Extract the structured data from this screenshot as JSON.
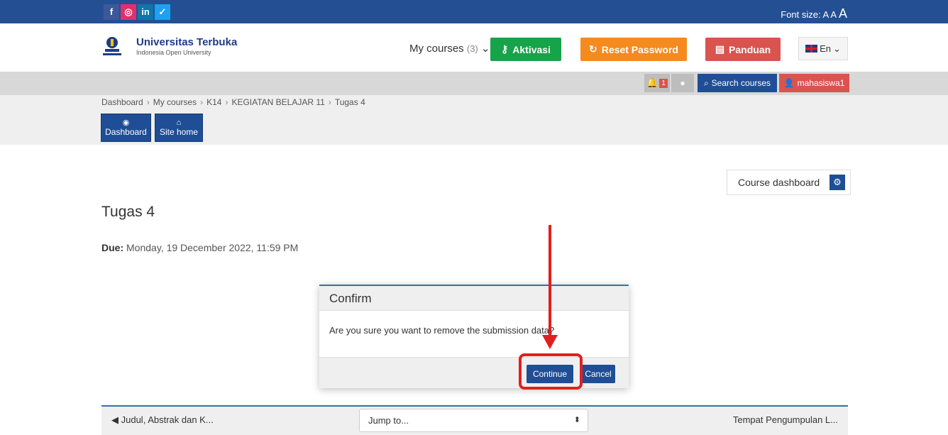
{
  "social": {
    "facebook": "f",
    "instagram": "◎",
    "linkedin": "in",
    "twitter": "✓"
  },
  "font_size": {
    "label": "Font size:",
    "small": "A",
    "medium": "A",
    "large": "A"
  },
  "brand": {
    "name": "Universitas Terbuka",
    "tagline": "Indonesia Open University"
  },
  "header": {
    "my_courses": "My courses",
    "my_courses_count": "(3)",
    "aktivasi": "Aktivasi",
    "reset_password": "Reset Password",
    "panduan": "Panduan",
    "language": "En"
  },
  "navbar": {
    "notif_count": "1",
    "search_courses": "Search courses",
    "username": "mahasiswa1"
  },
  "breadcrumb": [
    "Dashboard",
    "My courses",
    "K14",
    "KEGIATAN BELAJAR 11",
    "Tugas 4"
  ],
  "nav_buttons": {
    "dashboard": "Dashboard",
    "site_home": "Site home"
  },
  "course_dashboard": "Course dashboard",
  "page_title": "Tugas 4",
  "due": {
    "label": "Due:",
    "value": "Monday, 19 December 2022, 11:59 PM"
  },
  "modal": {
    "title": "Confirm",
    "message": "Are you sure you want to remove the submission data?",
    "continue": "Continue",
    "cancel": "Cancel"
  },
  "bottom_nav": {
    "prev": "◀ Judul, Abstrak dan K...",
    "jump": "Jump to...",
    "next": "Tempat Pengumpulan L..."
  },
  "colors": {
    "primary": "#1f4e96",
    "topbar": "#245093",
    "green": "#17a34a",
    "orange": "#f58a1f",
    "red": "#d9534f",
    "annotation": "#e02020"
  }
}
